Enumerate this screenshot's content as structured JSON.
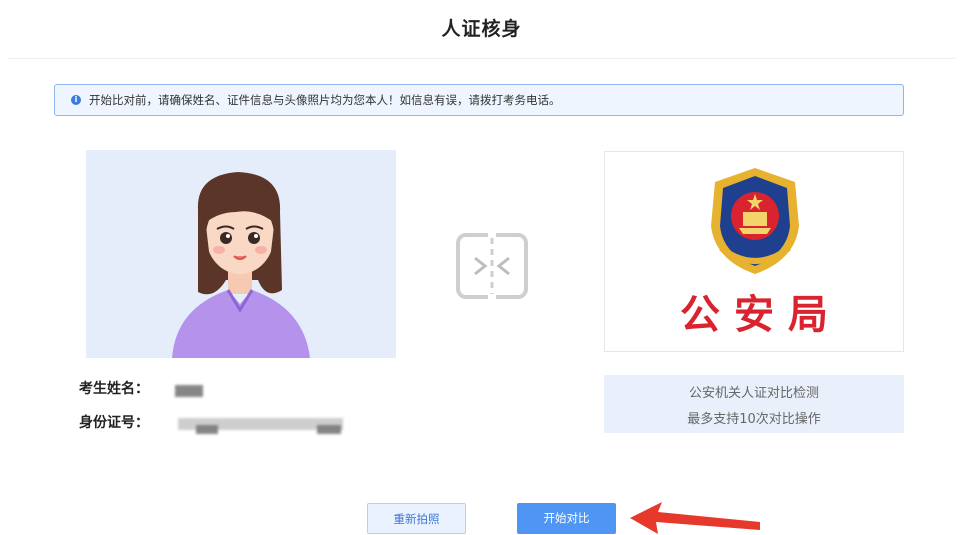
{
  "header": {
    "title": "人证核身"
  },
  "notice": {
    "icon": "info-icon",
    "text": "开始比对前，请确保姓名、证件信息与头像照片均为您本人！如信息有误，请拨打考务电话。"
  },
  "police": {
    "label": "公安局",
    "emblem_icon": "police-emblem-icon"
  },
  "candidate": {
    "name_label": "考生姓名：",
    "id_label": "身份证号："
  },
  "hint": {
    "line1": "公安机关人证对比检测",
    "line2": "最多支持10次对比操作"
  },
  "actions": {
    "retake_label": "重新拍照",
    "start_label": "开始对比"
  },
  "colors": {
    "accent": "#4f96f4",
    "police_red": "#d9232f",
    "notice_border": "#8fb6ee"
  }
}
